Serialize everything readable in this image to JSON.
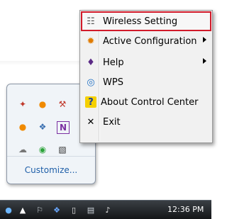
{
  "context_menu": {
    "items": [
      {
        "label": "Wireless Setting",
        "icon": "wireless-setting-icon",
        "submenu": false,
        "highlighted": true
      },
      {
        "label": "Active Configuration",
        "icon": "active-config-icon",
        "submenu": true,
        "highlighted": false
      },
      {
        "label": "Help",
        "icon": "help-book-icon",
        "submenu": true,
        "highlighted": false
      },
      {
        "label": "WPS",
        "icon": "wps-icon",
        "submenu": false,
        "highlighted": false
      },
      {
        "label": "About Control Center",
        "icon": "question-icon",
        "submenu": false,
        "highlighted": false
      },
      {
        "label": "Exit",
        "icon": "close-icon",
        "submenu": false,
        "highlighted": false
      }
    ],
    "highlight_color": "#d11a2a"
  },
  "tray_overflow": {
    "customize_label": "Customize...",
    "icons": [
      "adobe-icon",
      "orange-circle-icon",
      "tool-icon",
      "orange-dot-icon",
      "app-icon",
      "onenote-icon",
      "cloud-icon",
      "green-app-icon",
      "device-icon"
    ]
  },
  "taskbar": {
    "clock": "12:36 PM",
    "icons": [
      "network-user-icon",
      "show-hidden-arrow-icon",
      "action-center-icon",
      "bluetooth-icon",
      "usb-device-icon",
      "network-icon",
      "volume-icon"
    ]
  }
}
